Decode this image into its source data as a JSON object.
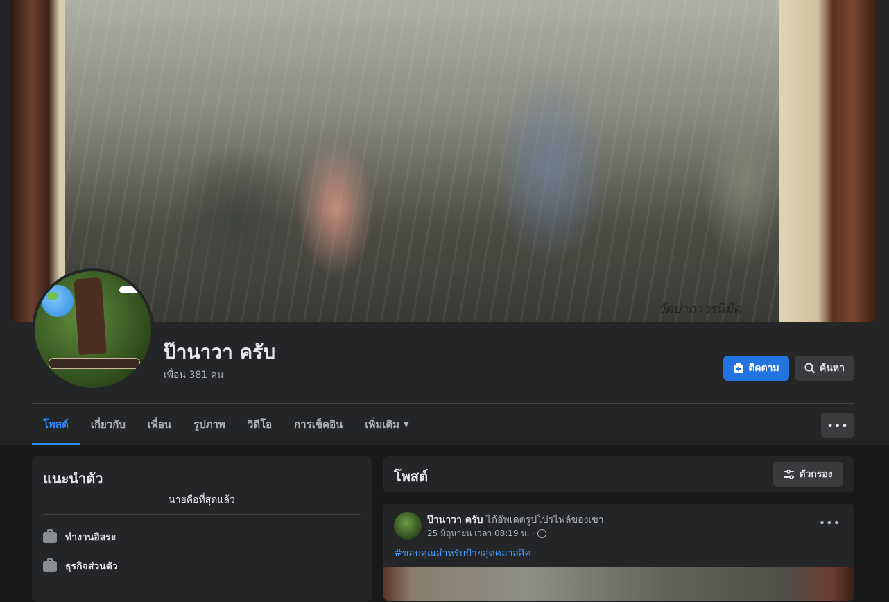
{
  "profile": {
    "name": "ป๊านาวา ครับ",
    "friends": "เพื่อน 381 คน",
    "cover_caption": "วัดป่าถาวรนิมิต"
  },
  "actions": {
    "follow_label": "ติดตาม",
    "search_label": "ค้นหา",
    "more_label": "•••"
  },
  "tabs": [
    {
      "label": "โพสต์",
      "active": true
    },
    {
      "label": "เกี่ยวกับ"
    },
    {
      "label": "เพื่อน"
    },
    {
      "label": "รูปภาพ"
    },
    {
      "label": "วิดีโอ"
    },
    {
      "label": "การเช็คอิน"
    },
    {
      "label": "เพิ่มเติม"
    }
  ],
  "intro": {
    "title": "แนะนำตัว",
    "bio": "นายคือที่สุดแล้ว",
    "items": [
      {
        "icon": "briefcase-icon",
        "label": "ทำงานอิสระ"
      },
      {
        "icon": "briefcase-icon",
        "label": "ธุรกิจส่วนตัว"
      }
    ]
  },
  "posts_section": {
    "title": "โพสต์",
    "filter_label": "ตัวกรอง"
  },
  "post": {
    "author": "ป๊านาวา ครับ",
    "action": "ได้อัพเดตรูปโปรไฟล์ของเขา",
    "time": "25 มิถุนายน เวลา 08:19 น. ·",
    "hashtag": "#ขอบคุณสำหรับป้ายสุดคลาสสิค",
    "menu": "•••"
  },
  "colors": {
    "accent": "#2374e1",
    "tab_active": "#2d88ff",
    "link": "#4599ff",
    "surface": "#242526",
    "background": "#18191a"
  }
}
